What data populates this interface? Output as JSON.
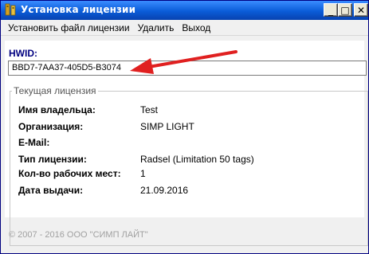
{
  "window": {
    "title": "Установка лицензии",
    "minimize_glyph": "_",
    "maximize_glyph": "□",
    "close_glyph": "✕"
  },
  "menu": {
    "items": [
      {
        "label": "Установить файл лицензии"
      },
      {
        "label": "Удалить"
      },
      {
        "label": "Выход"
      }
    ]
  },
  "hwid": {
    "label": "HWID:",
    "value": "BBD7-7AA37-405D5-B3074"
  },
  "license": {
    "group_title": "Текущая лицензия",
    "rows": [
      {
        "label": "Имя владельца:",
        "value": "Test"
      },
      {
        "label": "Организация:",
        "value": "SIMP LIGHT"
      },
      {
        "label": "E-Mail:",
        "value": ""
      },
      {
        "label": "Тип лицензии:",
        "value": "Radsel (Limitation 50 tags)"
      },
      {
        "label": "Кол-во рабочих мест:",
        "value": "1"
      },
      {
        "label": "Дата выдачи:",
        "value": "21.09.2016"
      }
    ]
  },
  "footer": {
    "copyright": "© 2007 - 2016  ООО \"СИМП ЛАЙТ\""
  },
  "colors": {
    "titlebar": "#0a5cd8",
    "hwid_label": "#000080",
    "arrow": "#e02020"
  }
}
